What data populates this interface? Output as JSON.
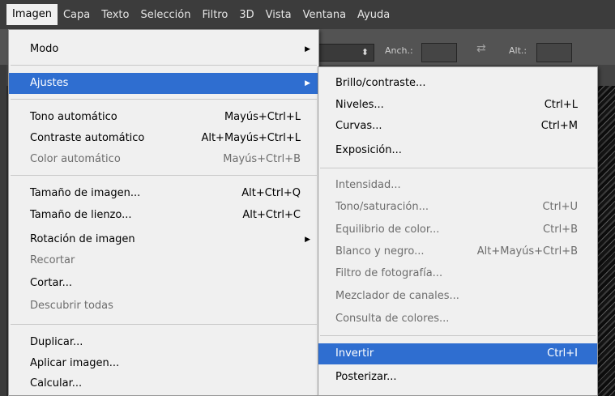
{
  "menubar": {
    "items": [
      "Imagen",
      "Capa",
      "Texto",
      "Selección",
      "Filtro",
      "3D",
      "Vista",
      "Ventana",
      "Ayuda"
    ],
    "active": "Imagen"
  },
  "options_bar": {
    "width_label": "Anch.:",
    "height_label": "Alt.:",
    "swap_icon": "swap-arrows-icon"
  },
  "imagen_menu": {
    "modo": "Modo",
    "ajustes": "Ajustes",
    "tono_auto": "Tono automático",
    "tono_auto_sc": "Mayús+Ctrl+L",
    "contraste_auto": "Contraste automático",
    "contraste_auto_sc": "Alt+Mayús+Ctrl+L",
    "color_auto": "Color automático",
    "color_auto_sc": "Mayús+Ctrl+B",
    "tam_imagen": "Tamaño de imagen...",
    "tam_imagen_sc": "Alt+Ctrl+Q",
    "tam_lienzo": "Tamaño de lienzo...",
    "tam_lienzo_sc": "Alt+Ctrl+C",
    "rotacion": "Rotación de imagen",
    "recortar": "Recortar",
    "cortar": "Cortar...",
    "descubrir": "Descubrir todas",
    "duplicar": "Duplicar...",
    "aplicar": "Aplicar imagen...",
    "calcular": "Calcular..."
  },
  "ajustes_menu": {
    "brillo": "Brillo/contraste...",
    "niveles": "Niveles...",
    "niveles_sc": "Ctrl+L",
    "curvas": "Curvas...",
    "curvas_sc": "Ctrl+M",
    "exposicion": "Exposición...",
    "intensidad": "Intensidad...",
    "tono_sat": "Tono/saturación...",
    "tono_sat_sc": "Ctrl+U",
    "equilibrio": "Equilibrio de color...",
    "equilibrio_sc": "Ctrl+B",
    "blanco_negro": "Blanco y negro...",
    "blanco_negro_sc": "Alt+Mayús+Ctrl+B",
    "filtro_foto": "Filtro de fotografía...",
    "mezclador": "Mezclador de canales...",
    "consulta": "Consulta de colores...",
    "invertir": "Invertir",
    "invertir_sc": "Ctrl+I",
    "posterizar": "Posterizar..."
  },
  "colors": {
    "highlight": "#2f6ed0",
    "menu_bg": "#f0f0f0",
    "menubar_bg": "#3c3c3c",
    "disabled_text": "#6d6d6d"
  }
}
